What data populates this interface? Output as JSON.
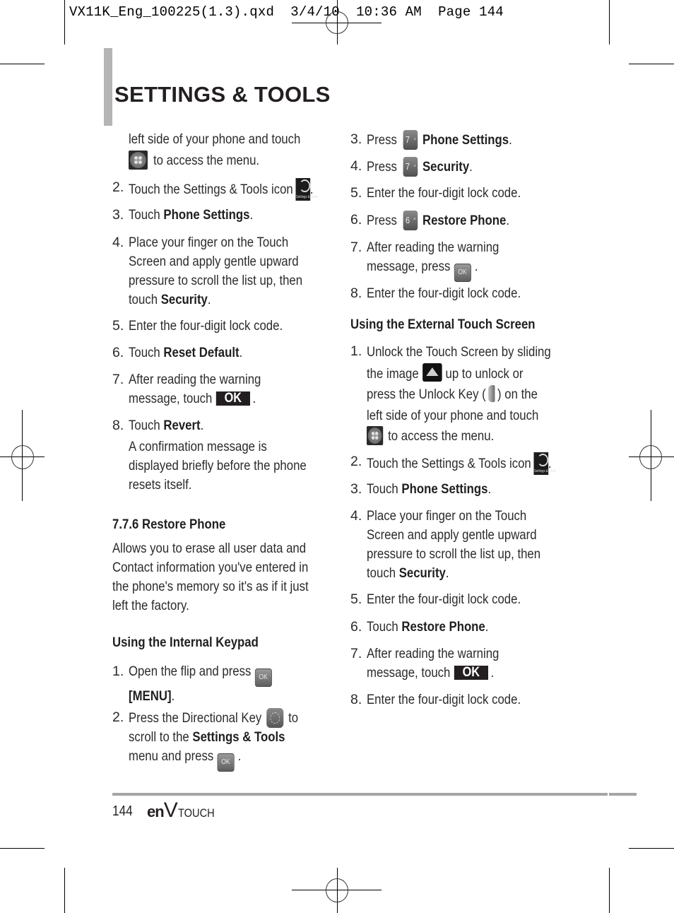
{
  "slug": "VX11K_Eng_100225(1.3).qxd  3/4/10  10:36 AM  Page 144",
  "title": "SETTINGS & TOOLS",
  "left_column": {
    "cont_line1": "left side of your phone and touch",
    "cont_line2": "to access the menu.",
    "steps_touch": [
      {
        "num": "2.",
        "text": "Touch the Settings & Tools icon",
        "suffix": "."
      },
      {
        "num": "3.",
        "pre": "Touch ",
        "bold": "Phone Settings",
        "post": "."
      },
      {
        "num": "4.",
        "lines": [
          "Place your finger on the Touch",
          "Screen and apply gentle upward",
          "pressure to scroll the list up, then"
        ],
        "last_pre": "touch ",
        "last_bold": "Security",
        "last_post": "."
      },
      {
        "num": "5.",
        "text": "Enter the four-digit lock code."
      },
      {
        "num": "6.",
        "pre": "Touch ",
        "bold": "Reset Default",
        "post": "."
      },
      {
        "num": "7.",
        "line1": "After reading the warning",
        "line2_pre": "message, touch",
        "ok": "OK",
        "line2_post": "."
      },
      {
        "num": "8.",
        "pre": "Touch ",
        "bold": "Revert",
        "post": ".",
        "note": [
          "A confirmation message is",
          "displayed briefly before the phone",
          "resets itself."
        ]
      }
    ],
    "section_heading": "7.7.6 Restore Phone",
    "section_desc": [
      "Allows you to erase all user data and",
      "Contact information you've entered in",
      "the phone's memory so it's as if it just",
      "left the factory."
    ],
    "sub_heading": "Using the Internal Keypad",
    "keypad_steps": [
      {
        "num": "1.",
        "line1": "Open the flip and press",
        "key": "OK",
        "line2": "[MENU]",
        "line2_post": "."
      },
      {
        "num": "2.",
        "line1_pre": "Press the Directional Key",
        "line1_post": "to",
        "line2_pre": "scroll to the ",
        "line2_bold": "Settings & Tools",
        "line3_pre": "menu and press",
        "key": "OK",
        "line3_post": "."
      }
    ]
  },
  "right_column": {
    "keypad_steps": [
      {
        "num": "3.",
        "pre": "Press",
        "key_digit": "7",
        "key_sup": "⁴",
        "bold": "Phone Settings",
        "post": "."
      },
      {
        "num": "4.",
        "pre": "Press",
        "key_digit": "7",
        "key_sup": "⁴",
        "bold": "Security",
        "post": "."
      },
      {
        "num": "5.",
        "text": "Enter the four-digit lock code."
      },
      {
        "num": "6.",
        "pre": "Press",
        "key_digit": "6",
        "key_sup": "^",
        "bold": "Restore Phone",
        "post": "."
      },
      {
        "num": "7.",
        "line1": "After reading the warning",
        "line2_pre": "message, press",
        "key": "OK",
        "line2_post": "."
      },
      {
        "num": "8.",
        "text": "Enter the four-digit lock code."
      }
    ],
    "sub_heading": "Using the External Touch Screen",
    "touch_steps": [
      {
        "num": "1.",
        "line1": "Unlock the Touch Screen by sliding",
        "line2_pre": "the image",
        "line2_post": "up to unlock or",
        "line3_pre": "press the Unlock Key (",
        "line3_post": ") on the",
        "line4": "left side of your phone and touch",
        "line5": "to access the menu."
      },
      {
        "num": "2.",
        "text": "Touch the Settings & Tools icon",
        "suffix": "."
      },
      {
        "num": "3.",
        "pre": "Touch ",
        "bold": "Phone Settings",
        "post": "."
      },
      {
        "num": "4.",
        "lines": [
          "Place your finger on the Touch",
          "Screen and apply gentle upward",
          "pressure to scroll the list up, then"
        ],
        "last_pre": "touch ",
        "last_bold": "Security",
        "last_post": "."
      },
      {
        "num": "5.",
        "text": "Enter the four-digit lock code."
      },
      {
        "num": "6.",
        "pre": "Touch ",
        "bold": "Restore Phone",
        "post": "."
      },
      {
        "num": "7.",
        "line1": "After reading the warning",
        "line2_pre": "message, touch",
        "ok": "OK",
        "line2_post": "."
      },
      {
        "num": "8.",
        "text": "Enter the four-digit lock code."
      }
    ]
  },
  "icons": {
    "settings_icon_caption": "Settings & Tools",
    "key_ok_label": "OK"
  },
  "footer": {
    "page_number": "144",
    "brand_en": "en",
    "brand_v": "V",
    "brand_touch": "TOUCH"
  }
}
